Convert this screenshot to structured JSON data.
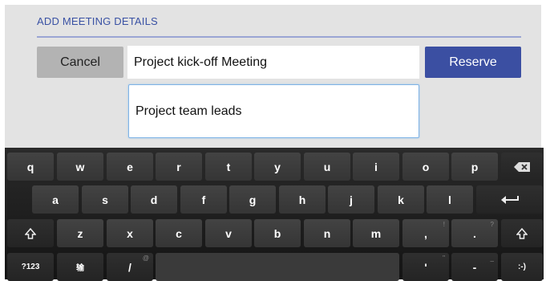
{
  "dialog": {
    "title": "ADD MEETING DETAILS",
    "cancel_label": "Cancel",
    "reserve_label": "Reserve",
    "meeting_title_value": "Project kick-off Meeting",
    "attendees_value": "Project team leads"
  },
  "keyboard": {
    "row1": [
      "q",
      "w",
      "e",
      "r",
      "t",
      "y",
      "u",
      "i",
      "o",
      "p"
    ],
    "row2": [
      "a",
      "s",
      "d",
      "f",
      "g",
      "h",
      "j",
      "k",
      "l"
    ],
    "row3": [
      "z",
      "x",
      "c",
      "v",
      "b",
      "n",
      "m"
    ],
    "comma": ",",
    "comma_hint": "!",
    "period": ".",
    "period_hint": "?",
    "symbols_label": "?123",
    "lang_label": "输",
    "slash": "/",
    "slash_hint": "@",
    "apostrophe": "'",
    "apostrophe_hint": "\"",
    "dash": "-",
    "dash_hint": "_",
    "smiley": ":-)"
  }
}
